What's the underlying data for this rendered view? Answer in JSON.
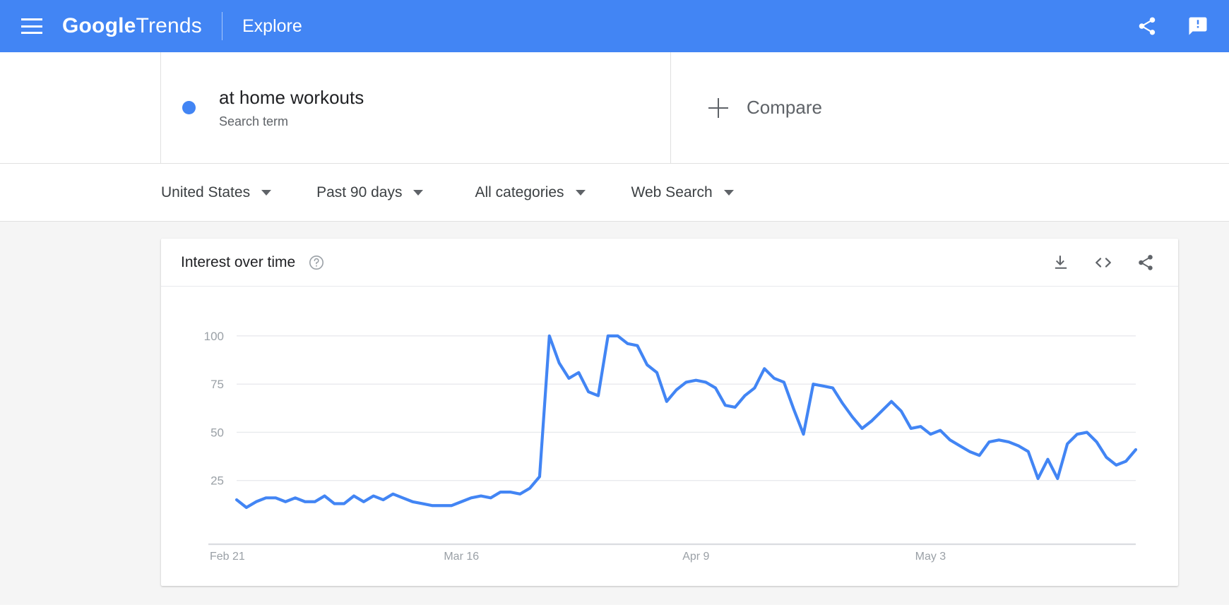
{
  "header": {
    "menu_icon": "hamburger-menu-icon",
    "brand_bold": "Google",
    "brand_light": "Trends",
    "explore": "Explore",
    "share_icon": "share-icon",
    "feedback_icon": "feedback-icon",
    "background_color": "#4285f4"
  },
  "query": {
    "term": "at home workouts",
    "term_type": "Search term",
    "dot_color": "#4285f4",
    "compare_label": "Compare"
  },
  "filters": [
    {
      "name": "location",
      "label": "United States"
    },
    {
      "name": "time-range",
      "label": "Past 90 days"
    },
    {
      "name": "category",
      "label": "All categories"
    },
    {
      "name": "search-type",
      "label": "Web Search"
    }
  ],
  "card": {
    "title": "Interest over time",
    "help_icon": "help-circle-icon",
    "download_icon": "download-icon",
    "embed_icon": "embed-code-icon",
    "share_icon": "share-icon"
  },
  "chart_data": {
    "type": "line",
    "title": "Interest over time",
    "xlabel": "",
    "ylabel": "",
    "ylim": [
      0,
      108
    ],
    "grid": true,
    "legend": false,
    "line_color": "#4285f4",
    "series_name": "at home workouts",
    "yticks": [
      25,
      50,
      75,
      100
    ],
    "xticks": [
      "Feb 21",
      "Mar 16",
      "Apr 9",
      "May 3"
    ],
    "xtick_indices": [
      0,
      23,
      47,
      71
    ],
    "x": [
      "Feb 21",
      "Feb 22",
      "Feb 23",
      "Feb 24",
      "Feb 25",
      "Feb 26",
      "Feb 27",
      "Feb 28",
      "Feb 29",
      "Mar 1",
      "Mar 2",
      "Mar 3",
      "Mar 4",
      "Mar 5",
      "Mar 6",
      "Mar 7",
      "Mar 8",
      "Mar 9",
      "Mar 10",
      "Mar 11",
      "Mar 12",
      "Mar 13",
      "Mar 14",
      "Mar 15",
      "Mar 16",
      "Mar 17",
      "Mar 18",
      "Mar 19",
      "Mar 20",
      "Mar 21",
      "Mar 22",
      "Mar 23",
      "Mar 24",
      "Mar 25",
      "Mar 26",
      "Mar 27",
      "Mar 28",
      "Mar 29",
      "Mar 30",
      "Mar 31",
      "Apr 1",
      "Apr 2",
      "Apr 3",
      "Apr 4",
      "Apr 5",
      "Apr 6",
      "Apr 7",
      "Apr 8",
      "Apr 9",
      "Apr 10",
      "Apr 11",
      "Apr 12",
      "Apr 13",
      "Apr 14",
      "Apr 15",
      "Apr 16",
      "Apr 17",
      "Apr 18",
      "Apr 19",
      "Apr 20",
      "Apr 21",
      "Apr 22",
      "Apr 23",
      "Apr 24",
      "Apr 25",
      "Apr 26",
      "Apr 27",
      "Apr 28",
      "Apr 29",
      "Apr 30",
      "May 1",
      "May 2",
      "May 3",
      "May 4",
      "May 5",
      "May 6",
      "May 7",
      "May 8",
      "May 9",
      "May 10",
      "May 11",
      "May 12",
      "May 13",
      "May 14",
      "May 15",
      "May 16",
      "May 17",
      "May 18",
      "May 19",
      "May 20",
      "May 21"
    ],
    "values": [
      15,
      11,
      14,
      16,
      16,
      14,
      16,
      14,
      14,
      17,
      13,
      13,
      17,
      14,
      17,
      15,
      18,
      16,
      14,
      13,
      12,
      12,
      12,
      14,
      16,
      17,
      16,
      19,
      19,
      18,
      21,
      27,
      100,
      86,
      78,
      81,
      71,
      69,
      100,
      100,
      96,
      95,
      85,
      81,
      66,
      72,
      76,
      77,
      76,
      73,
      64,
      63,
      69,
      73,
      83,
      78,
      76,
      62,
      49,
      75,
      74,
      73,
      65,
      58,
      52,
      56,
      61,
      66,
      61,
      52,
      53,
      49,
      51,
      46,
      43,
      40,
      38,
      45,
      46,
      45,
      43,
      40,
      26,
      36,
      26,
      44,
      49,
      50,
      45,
      37,
      33,
      35,
      41
    ]
  }
}
